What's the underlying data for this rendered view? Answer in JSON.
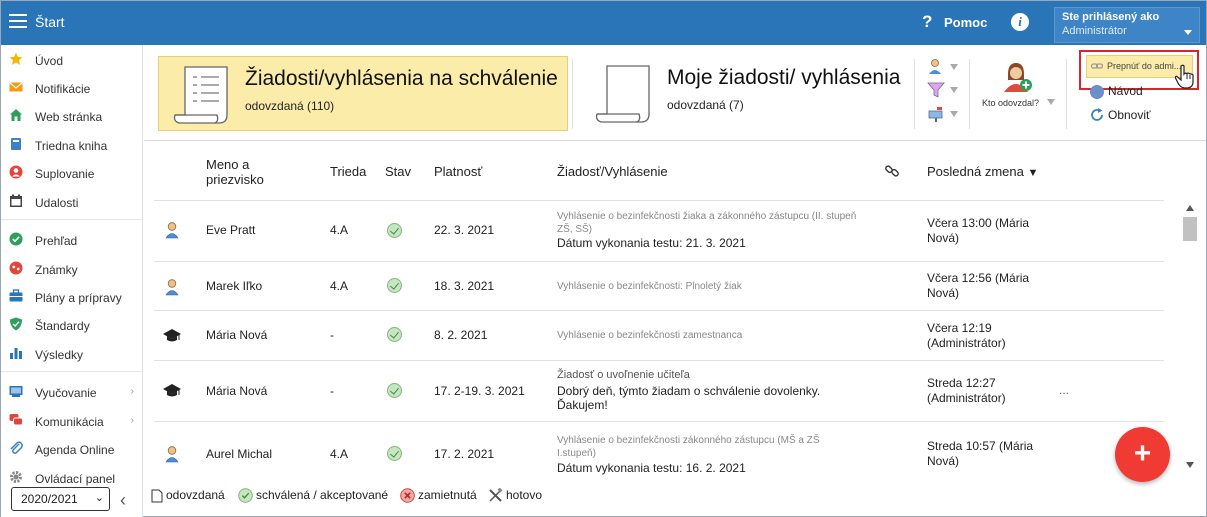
{
  "header": {
    "title": "Štart",
    "help_label": "Pomoc",
    "user": {
      "line1": "Ste prihlásený ako",
      "line2": "Administrátor"
    }
  },
  "sidebar": {
    "items": [
      {
        "label": "Úvod",
        "icon": "star-icon",
        "color": "#f4b400"
      },
      {
        "label": "Notifikácie",
        "icon": "envelope-icon",
        "color": "#f39c12"
      },
      {
        "label": "Web stránka",
        "icon": "home-icon",
        "color": "#2e9e5b"
      },
      {
        "label": "Triedna kniha",
        "icon": "book-icon",
        "color": "#3b82c4"
      },
      {
        "label": "Suplovanie",
        "icon": "person-icon",
        "color": "#e0463b"
      },
      {
        "label": "Udalosti",
        "icon": "calendar-icon",
        "color": "#444"
      },
      {
        "label": "Prehľad",
        "icon": "check-circle-icon",
        "color": "#2e9e5b"
      },
      {
        "label": "Známky",
        "icon": "grades-icon",
        "color": "#e0463b"
      },
      {
        "label": "Plány a prípravy",
        "icon": "briefcase-icon",
        "color": "#2a74b8"
      },
      {
        "label": "Štandardy",
        "icon": "shield-check-icon",
        "color": "#2e9e5b"
      },
      {
        "label": "Výsledky",
        "icon": "bar-chart-icon",
        "color": "#2a74b8"
      },
      {
        "label": "Vyučovanie",
        "icon": "classroom-icon",
        "color": "#2a74b8",
        "chevron": "›"
      },
      {
        "label": "Komunikácia",
        "icon": "chat-icon",
        "color": "#e0463b",
        "chevron": "›"
      },
      {
        "label": "Agenda Online",
        "icon": "paperclip-icon",
        "color": "#3b82c4"
      },
      {
        "label": "Ovládací panel",
        "icon": "gear-icon",
        "color": "#888"
      }
    ],
    "school_year": "2020/2021"
  },
  "panels": {
    "approval": {
      "title": "Žiadosti/vyhlásenia na schválenie",
      "sub": "odovzdaná (110)"
    },
    "mine": {
      "title": "Moje žiadosti/ vyhlásenia",
      "sub": "odovzdaná (7)"
    }
  },
  "toolbar": {
    "kto_label": "Kto odovzdal?",
    "prepnut_label": "Prepnúť do admi...",
    "navod_label": "Návod",
    "obnovit_label": "Obnoviť"
  },
  "table": {
    "headers": {
      "name": "Meno a priezvisko",
      "class": "Trieda",
      "state": "Stav",
      "validity": "Platnosť",
      "request": "Žiadosť/Vyhlásenie",
      "changed": "Posledná zmena",
      "sort_indicator": "▼"
    },
    "rows": [
      {
        "type": "student",
        "name": "Eve Pratt",
        "class": "4.A",
        "validity": "22. 3. 2021",
        "req_small": "Vyhlásenie o bezinfekčnosti žiaka a zákonného zástupcu (II. stupeň ZŠ, SŠ)",
        "req_main": "Dátum vykonania testu: 21. 3. 2021",
        "changed": "Včera 13:00 (Mária Nová)",
        "extra": ""
      },
      {
        "type": "student",
        "name": "Marek Iľko",
        "class": "4.A",
        "validity": "18. 3. 2021",
        "req_small": "Vyhlásenie o bezinfekčnosti: Plnoletý žiak",
        "req_main": "",
        "changed": "Včera 12:56 (Mária Nová)",
        "extra": ""
      },
      {
        "type": "teacher",
        "name": "Mária Nová",
        "class": "-",
        "validity": "8. 2. 2021",
        "req_small": "Vyhlásenie o bezinfekčnosti zamestnanca",
        "req_main": "",
        "changed": "Včera 12:19 (Administrátor)",
        "extra": ""
      },
      {
        "type": "teacher",
        "name": "Mária Nová",
        "class": "-",
        "validity": "17. 2-19. 3. 2021",
        "req_small": "Žiadosť o uvoľnenie učiteľa",
        "req_main": "Dobrý deň, týmto žiadam o schválenie dovolenky. Ďakujem!",
        "changed": "Streda 12:27 (Administrátor)",
        "extra": "..."
      },
      {
        "type": "student",
        "name": "Aurel Michal",
        "class": "4.A",
        "validity": "17. 2. 2021",
        "req_small": "Vyhlásenie o bezinfekčnosti zákonného zástupcu (MŠ a ZŠ I.stupeň)",
        "req_main": "Dátum vykonania testu: 16. 2. 2021",
        "changed": "Streda 10:57 (Mária Nová)",
        "extra": ""
      }
    ]
  },
  "fab_label": "+",
  "legend": {
    "submitted": "odovzdaná",
    "approved": "schválená / akceptované",
    "rejected": "zamietnutá",
    "done": "hotovo"
  }
}
